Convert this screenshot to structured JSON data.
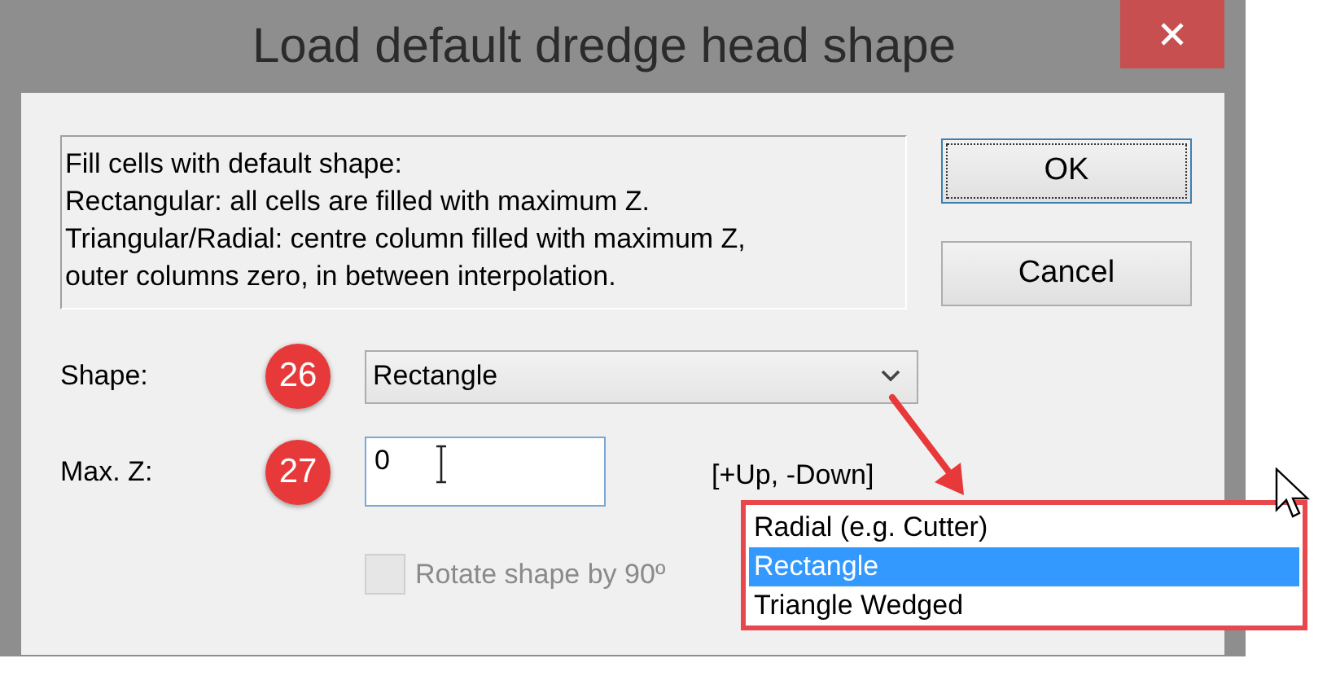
{
  "window": {
    "title": "Load default dredge head shape"
  },
  "description": [
    "Fill cells with default shape:",
    "Rectangular: all cells are filled with maximum Z.",
    "Triangular/Radial: centre column filled with maximum Z,",
    "outer columns zero, in between interpolation."
  ],
  "buttons": [
    {
      "label": "OK",
      "default": true
    },
    {
      "label": "Cancel",
      "default": false
    }
  ],
  "shape": {
    "label": "Shape:",
    "callout": "26",
    "value": "Rectangle",
    "options": [
      {
        "label": "Radial (e.g. Cutter)",
        "selected": false
      },
      {
        "label": "Rectangle",
        "selected": true
      },
      {
        "label": "Triangle Wedged",
        "selected": false
      }
    ]
  },
  "max_z": {
    "label": "Max. Z:",
    "callout": "27",
    "value": "0",
    "hint": "[+Up, -Down]"
  },
  "rotate": {
    "label": "Rotate shape by 90º",
    "checked": false,
    "disabled": true
  }
}
